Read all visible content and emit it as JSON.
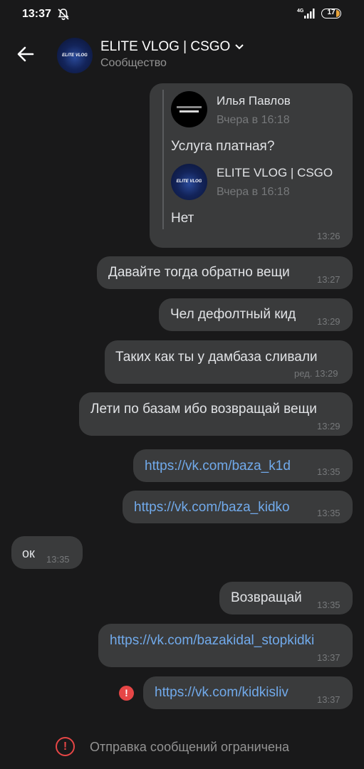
{
  "status_bar": {
    "time": "13:37",
    "network": "4G",
    "battery": "17"
  },
  "header": {
    "title": "ELITE VLOG | CSGO",
    "subtitle": "Сообщество",
    "avatar_text": "ELITE VLOG"
  },
  "quote_message": {
    "reply1": {
      "author": "Илья Павлов",
      "date": "Вчера в 16:18",
      "text": "Услуга платная?"
    },
    "reply2": {
      "author": "ELITE VLOG | CSGO",
      "date": "Вчера в 16:18",
      "text": "Нет"
    },
    "time": "13:26"
  },
  "messages": [
    {
      "text": "Давайте тогда обратно вещи",
      "time": "13:27"
    },
    {
      "text": "Чел дефолтный кид",
      "time": "13:29"
    },
    {
      "text": "Таких как ты у дамбаза сливали",
      "time": "ред. 13:29"
    },
    {
      "text": "Лети по базам ибо возвращай вещи",
      "time": "13:29"
    },
    {
      "text": "https://vk.com/baza_k1d",
      "time": "13:35"
    },
    {
      "text": "https://vk.com/baza_kidko",
      "time": "13:35"
    },
    {
      "text": "ок",
      "time": "13:35"
    },
    {
      "text": "Возвращай",
      "time": "13:35"
    },
    {
      "text": "https://vk.com/bazakidal_stopkidki",
      "time": "13:37"
    },
    {
      "text": "https://vk.com/kidkisliv",
      "time": "13:37"
    }
  ],
  "footer": {
    "text": "Отправка сообщений ограничена"
  },
  "colors": {
    "background": "#19191a",
    "bubble": "#3a3b3c",
    "link": "#71aaeb",
    "error": "#e64646"
  }
}
